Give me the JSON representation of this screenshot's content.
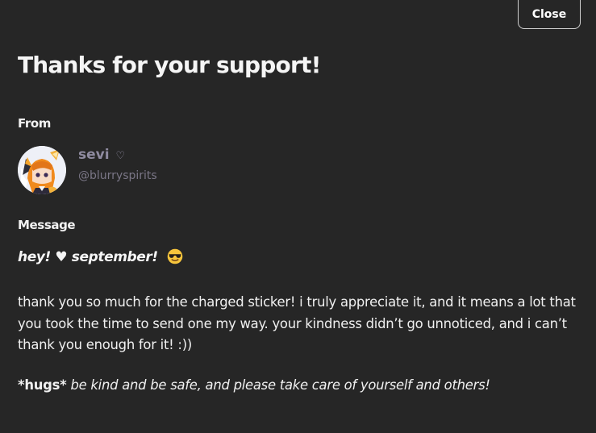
{
  "modal": {
    "close_label": "Close",
    "title": "Thanks for your support!"
  },
  "from": {
    "label": "From",
    "name": "sevi",
    "name_suffix": "♡",
    "handle": "@blurryspirits"
  },
  "message": {
    "label": "Message",
    "greeting": "hey! ♥ september!",
    "greeting_emoji": "smiling-face-with-sunglasses-icon",
    "body": "thank you so much for the charged sticker! i truly appreciate it, and it means a lot that you took the time to send one my way. your kindness didn’t go unnoticed, and i can’t thank you enough for it! :))",
    "closing_bold": "*hugs*",
    "closing_rest": "be kind and be safe, and please take care of yourself and others!"
  },
  "colors": {
    "background": "#262626",
    "text": "#f2f2f2",
    "muted_name": "#8f8ba0",
    "handle": "#7a7686"
  }
}
